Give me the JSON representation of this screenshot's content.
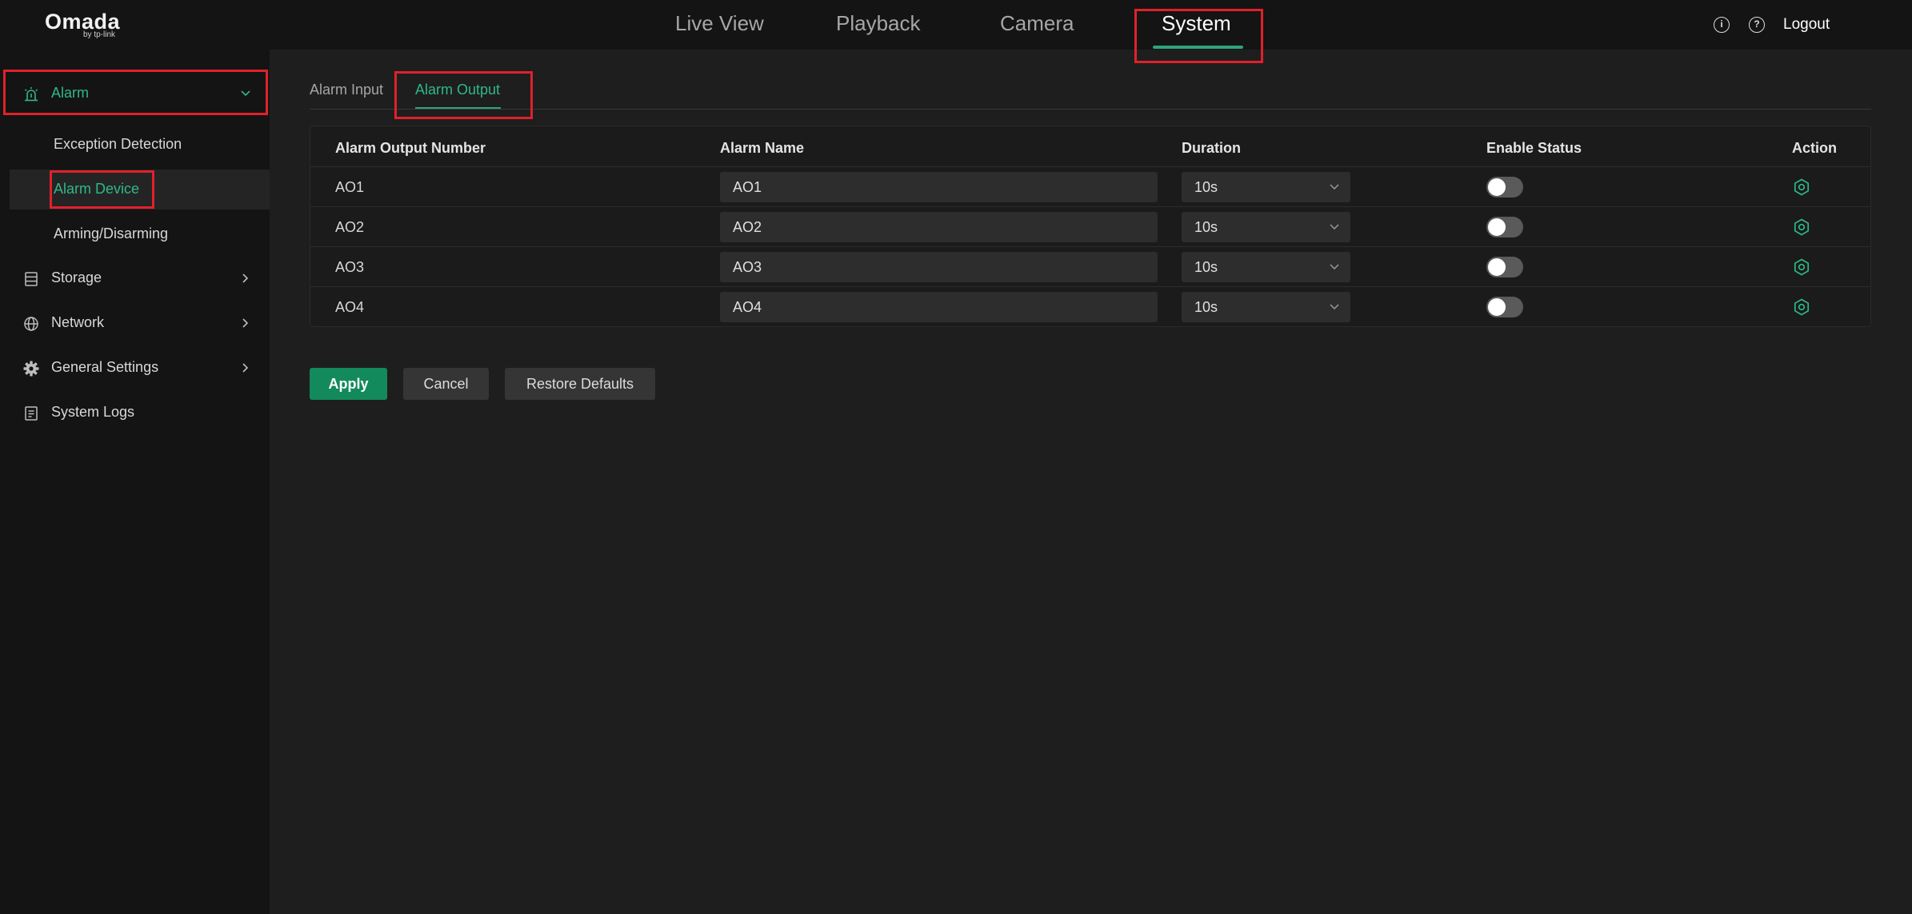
{
  "brand": {
    "name": "Omada",
    "sub": "by tp-link"
  },
  "nav": {
    "items": [
      "Live View",
      "Playback",
      "Camera",
      "System"
    ],
    "active": "System"
  },
  "header_right": {
    "info_icon": "info-icon",
    "help_icon": "help-icon",
    "logout_label": "Logout"
  },
  "sidebar": {
    "alarm": {
      "label": "Alarm",
      "icon": "alarm-siren-icon",
      "expanded": true
    },
    "sub_items": [
      "Exception Detection",
      "Alarm Device",
      "Arming/Disarming"
    ],
    "selected_sub_item": "Alarm Device",
    "items": [
      {
        "label": "Storage",
        "icon": "storage-icon"
      },
      {
        "label": "Network",
        "icon": "globe-icon"
      },
      {
        "label": "General Settings",
        "icon": "gear-icon"
      },
      {
        "label": "System Logs",
        "icon": "document-icon"
      }
    ]
  },
  "tabs": {
    "items": [
      "Alarm Input",
      "Alarm Output"
    ],
    "active": "Alarm Output"
  },
  "table": {
    "headers": [
      "Alarm Output Number",
      "Alarm Name",
      "Duration",
      "Enable Status",
      "Action"
    ],
    "rows": [
      {
        "number": "AO1",
        "name": "AO1",
        "duration": "10s",
        "enabled": false
      },
      {
        "number": "AO2",
        "name": "AO2",
        "duration": "10s",
        "enabled": false
      },
      {
        "number": "AO3",
        "name": "AO3",
        "duration": "10s",
        "enabled": false
      },
      {
        "number": "AO4",
        "name": "AO4",
        "duration": "10s",
        "enabled": false
      }
    ]
  },
  "buttons": {
    "apply": "Apply",
    "cancel": "Cancel",
    "restore": "Restore Defaults"
  },
  "colors": {
    "accent": "#2fb886",
    "apply_bg": "#138a5c",
    "highlight": "#e0212b",
    "background": "#1e1e1e",
    "sidebar_bg": "#141414"
  }
}
